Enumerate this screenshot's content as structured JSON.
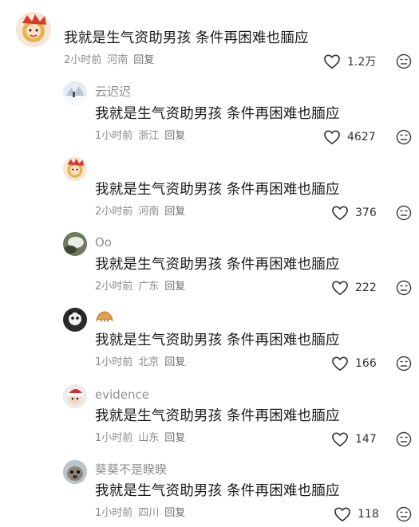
{
  "comments": [
    {
      "name": "",
      "text": "我就是生气资助男孩 条件再困难也腼应",
      "time": "2小时前",
      "region": "河南",
      "reply": "回复",
      "likes": "1.2万",
      "avatar": "lion-dance-avatar"
    },
    {
      "name": "云迟迟",
      "text": "我就是生气资助男孩 条件再困难也腼应",
      "time": "1小时前",
      "region": "浙江",
      "reply": "回复",
      "likes": "4627",
      "avatar": "snow-scene-avatar"
    },
    {
      "name": "",
      "text": "我就是生气资助男孩 条件再困难也腼应",
      "time": "2小时前",
      "region": "河南",
      "reply": "回复",
      "likes": "376",
      "avatar": "lion-dance-avatar"
    },
    {
      "name": "Oo",
      "text": "我就是生气资助男孩 条件再困难也腼应",
      "time": "2小时前",
      "region": "广东",
      "reply": "回复",
      "likes": "222",
      "avatar": "green-blur-avatar"
    },
    {
      "name": "",
      "name_emoji": "croissant-emoji",
      "text": "我就是生气资助男孩 条件再困难也腼应",
      "time": "1小时前",
      "region": "北京",
      "reply": "回复",
      "likes": "166",
      "avatar": "dark-cat-avatar"
    },
    {
      "name": "evidence",
      "text": "我就是生气资助男孩 条件再困难也腼应",
      "time": "1小时前",
      "region": "山东",
      "reply": "回复",
      "likes": "147",
      "avatar": "santa-hat-avatar"
    },
    {
      "name": "葵葵不是睽睽",
      "text": "我就是生气资助男孩 条件再困难也腼应",
      "time": "1小时前",
      "region": "四川",
      "reply": "回复",
      "likes": "118",
      "avatar": "seal-avatar"
    }
  ],
  "icons": {
    "like": "heart-outline-icon",
    "dislike": "frown-face-icon"
  },
  "colors": {
    "text": "#1a1a1a",
    "meta": "#8a8a8a",
    "name": "#8e8e8e",
    "background": "#ffffff"
  }
}
